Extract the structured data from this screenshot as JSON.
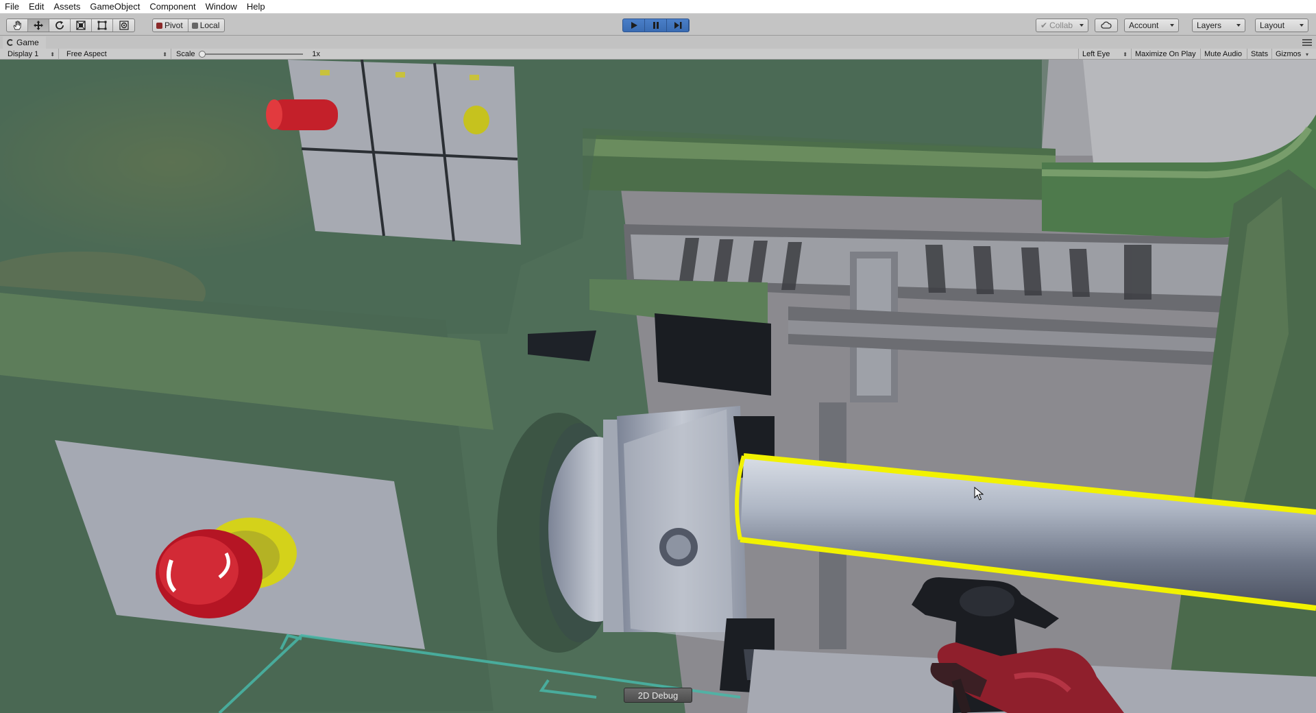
{
  "menu": [
    "File",
    "Edit",
    "Assets",
    "GameObject",
    "Component",
    "Window",
    "Help"
  ],
  "toolbar": {
    "tools": [
      "hand-icon",
      "move-icon",
      "rotate-icon",
      "scale-icon",
      "rect-icon",
      "transform-icon"
    ],
    "pivot_label": "Pivot",
    "local_label": "Local",
    "collab_label": "Collab",
    "account_label": "Account",
    "layers_label": "Layers",
    "layout_label": "Layout"
  },
  "game_tab": {
    "label": "Game"
  },
  "game_bar": {
    "display": "Display 1",
    "aspect": "Free Aspect",
    "scale_label": "Scale",
    "scale_value": "1x",
    "eye": "Left Eye",
    "maximize": "Maximize On Play",
    "mute": "Mute Audio",
    "stats": "Stats",
    "gizmos": "Gizmos"
  },
  "viewport": {
    "debug_button": "2D Debug"
  },
  "colors": {
    "play_accent": "#3a6cb3",
    "highlight": "#f2f200",
    "machine_green": "#4f6e58"
  }
}
